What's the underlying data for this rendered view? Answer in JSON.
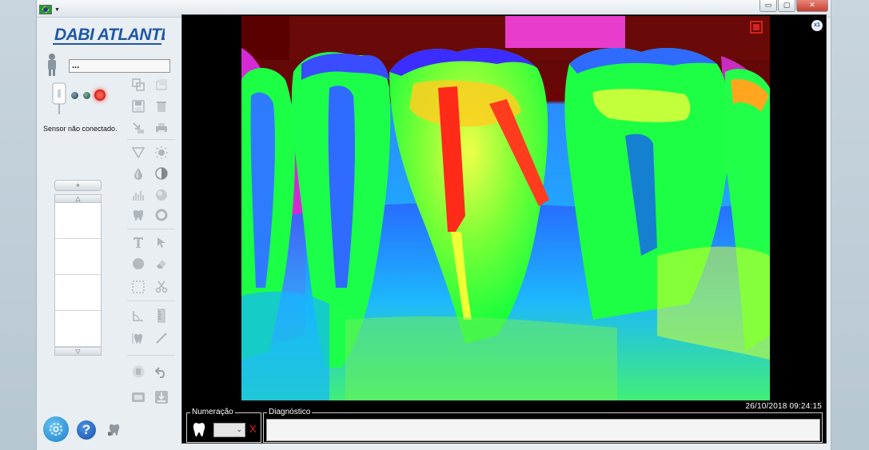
{
  "window": {
    "language_flag": "brazil-flag-icon",
    "controls": {
      "minimize": "▭",
      "restore": "▢",
      "close": "✕"
    }
  },
  "brand": {
    "logo_text": "DABI ATLANTE"
  },
  "patient": {
    "name_value": "..."
  },
  "sensor": {
    "status_text": "Sensor não conectado.",
    "indicator_color": "#ff3b30"
  },
  "thumbnails": {
    "add_label": "+",
    "up_label": "△",
    "down_label": "▽",
    "slots": 4
  },
  "viewer": {
    "zoom_badge": "x1",
    "timestamp": "26/10/2018 09:24:15",
    "numeracao_label": "Numeração",
    "numeracao_value": "",
    "clear_label": "X",
    "diagnostico_label": "Diagnóstico",
    "diagnostico_value": ""
  },
  "colors": {
    "brand_blue": "#1f57a6",
    "stop_red": "#d4241b"
  }
}
